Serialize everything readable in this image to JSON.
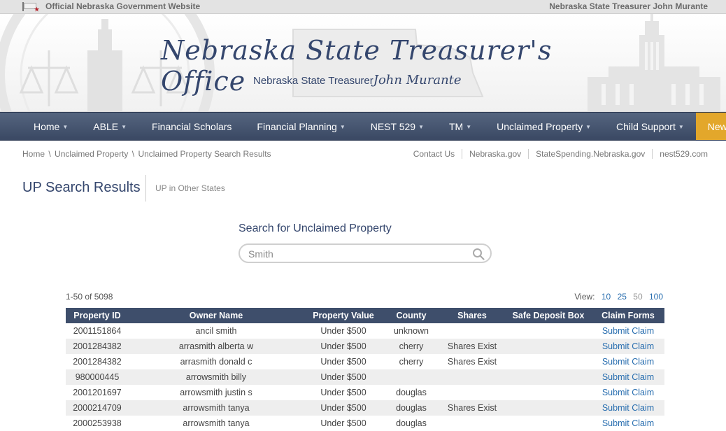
{
  "topbar": {
    "left": "Official Nebraska Government Website",
    "right": "Nebraska State Treasurer John Murante"
  },
  "banner": {
    "title": "Nebraska State Treasurer's Office",
    "subtitle": "Nebraska State Treasurer",
    "signature": "John Murante"
  },
  "nav": [
    {
      "label": "Home",
      "caret": true
    },
    {
      "label": "ABLE",
      "caret": true
    },
    {
      "label": "Financial Scholars",
      "caret": false
    },
    {
      "label": "Financial Planning",
      "caret": true
    },
    {
      "label": "NEST 529",
      "caret": true
    },
    {
      "label": "TM",
      "caret": true
    },
    {
      "label": "Unclaimed Property",
      "caret": true
    },
    {
      "label": "Child Support",
      "caret": true
    },
    {
      "label": "News",
      "caret": false
    }
  ],
  "breadcrumb": [
    "Home",
    "Unclaimed Property",
    "Unclaimed Property Search Results"
  ],
  "breadcrumb_sep": "\\",
  "utility_links": [
    "Contact Us",
    "Nebraska.gov",
    "StateSpending.Nebraska.gov",
    "nest529.com"
  ],
  "page": {
    "title": "UP Search Results",
    "other_states": "UP in Other States"
  },
  "search": {
    "label": "Search for Unclaimed Property",
    "value": "Smith"
  },
  "results": {
    "count": "1-50 of 5098",
    "view_label": "View:",
    "view_options": [
      "10",
      "25",
      "50",
      "100"
    ],
    "view_current": "50",
    "columns": [
      "Property ID",
      "Owner Name",
      "Property Value",
      "County",
      "Shares",
      "Safe Deposit Box",
      "Claim Forms"
    ],
    "rows": [
      [
        "2001151864",
        "ancil smith",
        "Under $500",
        "unknown",
        "",
        "",
        "Submit Claim"
      ],
      [
        "2001284382",
        "arrasmith alberta w",
        "Under $500",
        "cherry",
        "Shares Exist",
        "",
        "Submit Claim"
      ],
      [
        "2001284382",
        "arrasmith donald c",
        "Under $500",
        "cherry",
        "Shares Exist",
        "",
        "Submit Claim"
      ],
      [
        "980000445",
        "arrowsmith billy",
        "Under $500",
        "",
        "",
        "",
        "Submit Claim"
      ],
      [
        "2001201697",
        "arrowsmith justin s",
        "Under $500",
        "douglas",
        "",
        "",
        "Submit Claim"
      ],
      [
        "2000214709",
        "arrowsmith tanya",
        "Under $500",
        "douglas",
        "Shares Exist",
        "",
        "Submit Claim"
      ],
      [
        "2000253938",
        "arrowsmith tanya",
        "Under $500",
        "douglas",
        "",
        "",
        "Submit Claim"
      ]
    ]
  },
  "colors": {
    "nav_bg": "#3e4e6b",
    "accent_news": "#e3a72b",
    "link": "#2a6fb0",
    "heading": "#34466d"
  }
}
